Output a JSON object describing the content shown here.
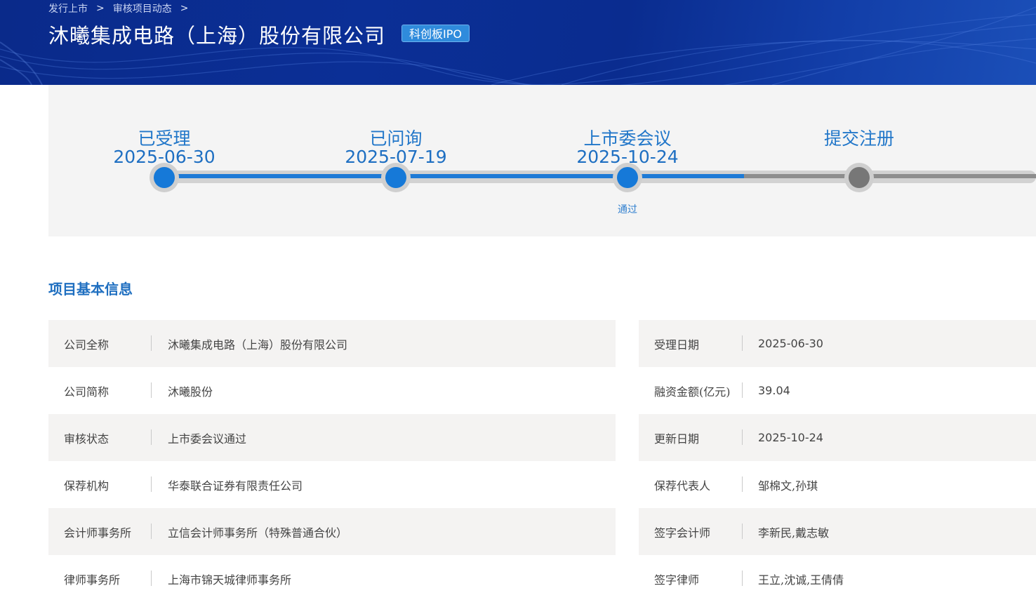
{
  "breadcrumb": [
    "发行上市",
    "审核项目动态"
  ],
  "title": "沐曦集成电路（上海）股份有限公司",
  "badge": "科创板IPO",
  "steps": [
    {
      "name": "已受理",
      "date": "2025-06-30",
      "note": ""
    },
    {
      "name": "已问询",
      "date": "2025-07-19",
      "note": ""
    },
    {
      "name": "上市委会议",
      "date": "2025-10-24",
      "note": "通过"
    },
    {
      "name": "提交注册",
      "date": "",
      "note": ""
    }
  ],
  "section_title": "项目基本信息",
  "left_rows": [
    {
      "label": "公司全称",
      "value": "沐曦集成电路（上海）股份有限公司"
    },
    {
      "label": "公司简称",
      "value": "沐曦股份"
    },
    {
      "label": "审核状态",
      "value": "上市委会议通过"
    },
    {
      "label": "保荐机构",
      "value": "华泰联合证券有限责任公司"
    },
    {
      "label": "会计师事务所",
      "value": "立信会计师事务所（特殊普通合伙）"
    },
    {
      "label": "律师事务所",
      "value": "上海市锦天城律师事务所"
    }
  ],
  "right_rows": [
    {
      "label": "受理日期",
      "value": "2025-06-30"
    },
    {
      "label": "融资金额(亿元)",
      "value": "39.04"
    },
    {
      "label": "更新日期",
      "value": "2025-10-24"
    },
    {
      "label": "保荐代表人",
      "value": "邹棉文,孙琪"
    },
    {
      "label": "签字会计师",
      "value": "李新民,戴志敏"
    },
    {
      "label": "签字律师",
      "value": "王立,沈诚,王倩倩"
    }
  ],
  "colors": {
    "banner": "#0b2f96",
    "accent": "#1679d8",
    "pending": "#777777",
    "panel": "#f4f4f4"
  }
}
